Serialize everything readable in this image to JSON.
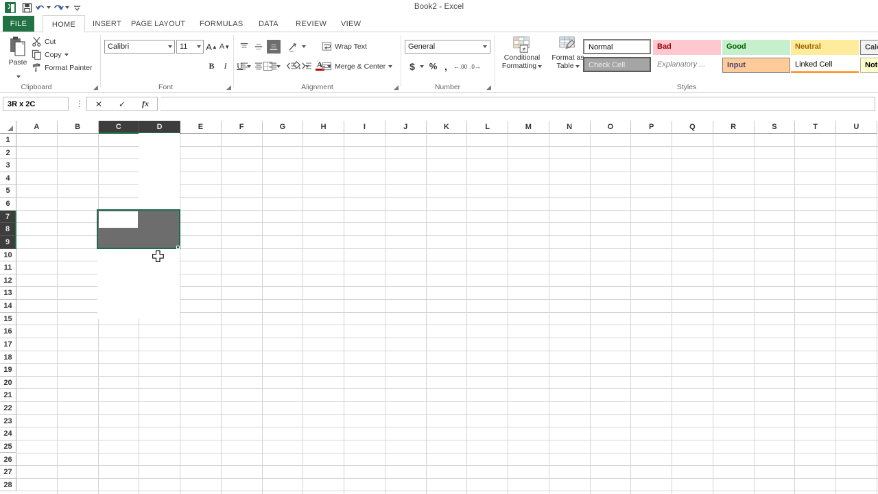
{
  "window": {
    "title": "Book2 - Excel",
    "app_icon": "excel-logo-icon"
  },
  "quick_access": [
    {
      "name": "save-icon",
      "label": "Save"
    },
    {
      "name": "undo-icon",
      "label": "Undo"
    },
    {
      "name": "redo-icon",
      "label": "Redo"
    },
    {
      "name": "customize-qat-icon",
      "label": "Customize Quick Access Toolbar"
    }
  ],
  "tabs": [
    {
      "label": "FILE",
      "active": false,
      "file": true
    },
    {
      "label": "HOME",
      "active": true
    },
    {
      "label": "INSERT",
      "active": false
    },
    {
      "label": "PAGE LAYOUT",
      "active": false
    },
    {
      "label": "FORMULAS",
      "active": false
    },
    {
      "label": "DATA",
      "active": false
    },
    {
      "label": "REVIEW",
      "active": false
    },
    {
      "label": "VIEW",
      "active": false
    }
  ],
  "ribbon": {
    "clipboard": {
      "group_label": "Clipboard",
      "paste_label": "Paste",
      "cut_label": "Cut",
      "copy_label": "Copy",
      "format_painter_label": "Format Painter"
    },
    "font": {
      "group_label": "Font",
      "font_name": "Calibri",
      "font_size": "11",
      "grow_font_label": "A",
      "shrink_font_label": "A",
      "bold_label": "B",
      "italic_label": "I",
      "underline_label": "U",
      "borders_label": "Borders",
      "fill_color_label": "Fill Color",
      "font_color_label": "A"
    },
    "alignment": {
      "group_label": "Alignment",
      "wrap_text_label": "Wrap Text",
      "merge_center_label": "Merge & Center",
      "top_align_label": "Top Align",
      "middle_align_label": "Middle Align",
      "bottom_align_label": "Bottom Align",
      "align_left_label": "Align Left",
      "center_label": "Center",
      "align_right_label": "Align Right",
      "orientation_label": "Orientation",
      "decrease_indent_label": "Decrease Indent",
      "increase_indent_label": "Increase Indent"
    },
    "number": {
      "group_label": "Number",
      "format_value": "General",
      "accounting_label": "$",
      "percent_label": "%",
      "comma_label": ",",
      "increase_decimal_label": ".00",
      "decrease_decimal_label": ".0"
    },
    "styles": {
      "group_label": "Styles",
      "conditional_formatting_line1": "Conditional",
      "conditional_formatting_line2": "Formatting",
      "format_as_table_line1": "Format as",
      "format_as_table_line2": "Table",
      "gallery_row1": [
        {
          "label": "Normal",
          "bg": "#ffffff",
          "fg": "#000000",
          "border": "#7f7f7f",
          "selected": true
        },
        {
          "label": "Bad",
          "bg": "#ffc7ce",
          "fg": "#9c0006",
          "border": "#ffc7ce"
        },
        {
          "label": "Good",
          "bg": "#c6efce",
          "fg": "#006100",
          "border": "#c6efce"
        },
        {
          "label": "Neutral",
          "bg": "#ffeb9c",
          "fg": "#9c6500",
          "border": "#ffeb9c"
        },
        {
          "label": "Calcul",
          "bg": "#f2f2f2",
          "fg": "#7f7f7f",
          "border": "#7f7f7f"
        }
      ],
      "gallery_row2": [
        {
          "label": "Check Cell",
          "bg": "#a5a5a5",
          "fg": "#ffffff",
          "border": "#5a5a5a"
        },
        {
          "label": "Explanatory ...",
          "bg": "#ffffff",
          "fg": "#7f7f7f",
          "border": "#ffffff",
          "italic": true
        },
        {
          "label": "Input",
          "bg": "#ffcc99",
          "fg": "#3f3f76",
          "border": "#7f7f7f"
        },
        {
          "label": "Linked Cell",
          "bg": "#ffffff",
          "fg": "#000000",
          "border": "#ffffff",
          "underline": "#ff8001"
        },
        {
          "label": "Note",
          "bg": "#ffffcc",
          "fg": "#000000",
          "border": "#b2b2b2"
        }
      ]
    }
  },
  "formula_bar": {
    "name_box_value": "3R x 2C",
    "cancel_label": "✕",
    "enter_label": "✓",
    "insert_function_label": "fx",
    "formula_value": "",
    "expand_label": "⋮"
  },
  "grid": {
    "columns": [
      "A",
      "B",
      "C",
      "D",
      "E",
      "F",
      "G",
      "H",
      "I",
      "J",
      "K",
      "L",
      "M",
      "N",
      "O",
      "P",
      "Q",
      "R",
      "S",
      "T",
      "U"
    ],
    "rows": [
      "1",
      "2",
      "3",
      "4",
      "5",
      "6",
      "7",
      "8",
      "9",
      "10",
      "11",
      "12",
      "13",
      "14",
      "15",
      "16",
      "17",
      "18",
      "19",
      "20",
      "21",
      "22",
      "23",
      "24",
      "25",
      "26",
      "27",
      "28"
    ],
    "selected_columns": [
      "C",
      "D"
    ],
    "selected_rows": [
      "7",
      "8",
      "9"
    ],
    "selection_range": "C7:D9",
    "active_cell": "C7",
    "selection_size_label": "3R x 2C",
    "cursor": "white-cross-cursor",
    "cell_values": []
  },
  "colors": {
    "accent_green": "#217346",
    "selection_border": "#1f6b50",
    "selection_fill": "#6d6d6d",
    "header_selected_bg": "#3d3d3d",
    "gridline": "#d4d4d4"
  }
}
